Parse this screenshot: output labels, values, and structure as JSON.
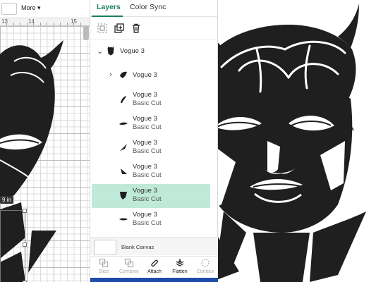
{
  "toolbar": {
    "zoom_value": "",
    "more_label": "More"
  },
  "ruler": {
    "marks": [
      "13",
      "14",
      "15"
    ]
  },
  "canvas": {
    "dimension_label": "9 in"
  },
  "tabs": [
    {
      "label": "Layers",
      "active": true
    },
    {
      "label": "Color Sync",
      "active": false
    }
  ],
  "actions": {
    "group_icon": "group-icon",
    "duplicate_icon": "duplicate-icon",
    "delete_icon": "trash-icon"
  },
  "layers": [
    {
      "name": "Vogue 3",
      "sub": "",
      "level": 0,
      "chevron": "down"
    },
    {
      "name": "Vogue 3",
      "sub": "",
      "level": 1,
      "chevron": "right"
    },
    {
      "name": "Vogue 3",
      "sub": "Basic Cut",
      "level": 1,
      "chevron": ""
    },
    {
      "name": "Vogue 3",
      "sub": "Basic Cut",
      "level": 1,
      "chevron": ""
    },
    {
      "name": "Vogue 3",
      "sub": "Basic Cut",
      "level": 1,
      "chevron": ""
    },
    {
      "name": "Vogue 3",
      "sub": "Basic Cut",
      "level": 1,
      "chevron": ""
    },
    {
      "name": "Vogue 3",
      "sub": "Basic Cut",
      "level": 1,
      "chevron": "",
      "selected": true
    },
    {
      "name": "Vogue 3",
      "sub": "Basic Cut",
      "level": 1,
      "chevron": ""
    }
  ],
  "blank_canvas": {
    "label": "Blank Canvas"
  },
  "bottom_actions": [
    {
      "label": "Slice",
      "enabled": false
    },
    {
      "label": "Combine",
      "enabled": false
    },
    {
      "label": "Attach",
      "enabled": true
    },
    {
      "label": "Flatten",
      "enabled": true
    },
    {
      "label": "Contour",
      "enabled": false
    }
  ],
  "colors": {
    "accent": "#1a7f5a",
    "selected_row": "#bfe9d9",
    "art": "#1f1f1f",
    "bottom_bar": "#1d4ba8"
  }
}
